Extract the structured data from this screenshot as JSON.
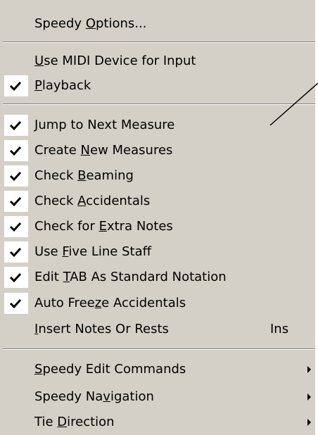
{
  "menu": {
    "items": [
      {
        "before": "Speedy ",
        "mn": "O",
        "after": "ptions..."
      },
      {
        "before": "",
        "mn": "U",
        "after": "se MIDI Device for Input"
      },
      {
        "before": "",
        "mn": "P",
        "after": "layback",
        "checked": true
      },
      {
        "before": "",
        "mn": "J",
        "after": "ump to Next Measure",
        "checked": true
      },
      {
        "before": "Create ",
        "mn": "N",
        "after": "ew Measures",
        "checked": true
      },
      {
        "before": "Check ",
        "mn": "B",
        "after": "eaming",
        "checked": true
      },
      {
        "before": "Check ",
        "mn": "A",
        "after": "ccidentals",
        "checked": true
      },
      {
        "before": "Check for ",
        "mn": "E",
        "after": "xtra Notes",
        "checked": true
      },
      {
        "before": "Use ",
        "mn": "F",
        "after": "ive Line Staff",
        "checked": true
      },
      {
        "before": "Edit ",
        "mn": "T",
        "after": "AB As Standard Notation",
        "checked": true
      },
      {
        "before": "Auto Free",
        "mn": "z",
        "after": "e Accidentals",
        "checked": true
      },
      {
        "before": "",
        "mn": "I",
        "after": "nsert Notes Or Rests",
        "shortcut": "Ins"
      },
      {
        "before": "",
        "mn": "S",
        "after": "peedy Edit Commands",
        "submenu": true
      },
      {
        "before": "Speedy Na",
        "mn": "v",
        "after": "igation",
        "submenu": true
      },
      {
        "before": "Tie ",
        "mn": "D",
        "after": "irection",
        "submenu": true
      }
    ]
  }
}
